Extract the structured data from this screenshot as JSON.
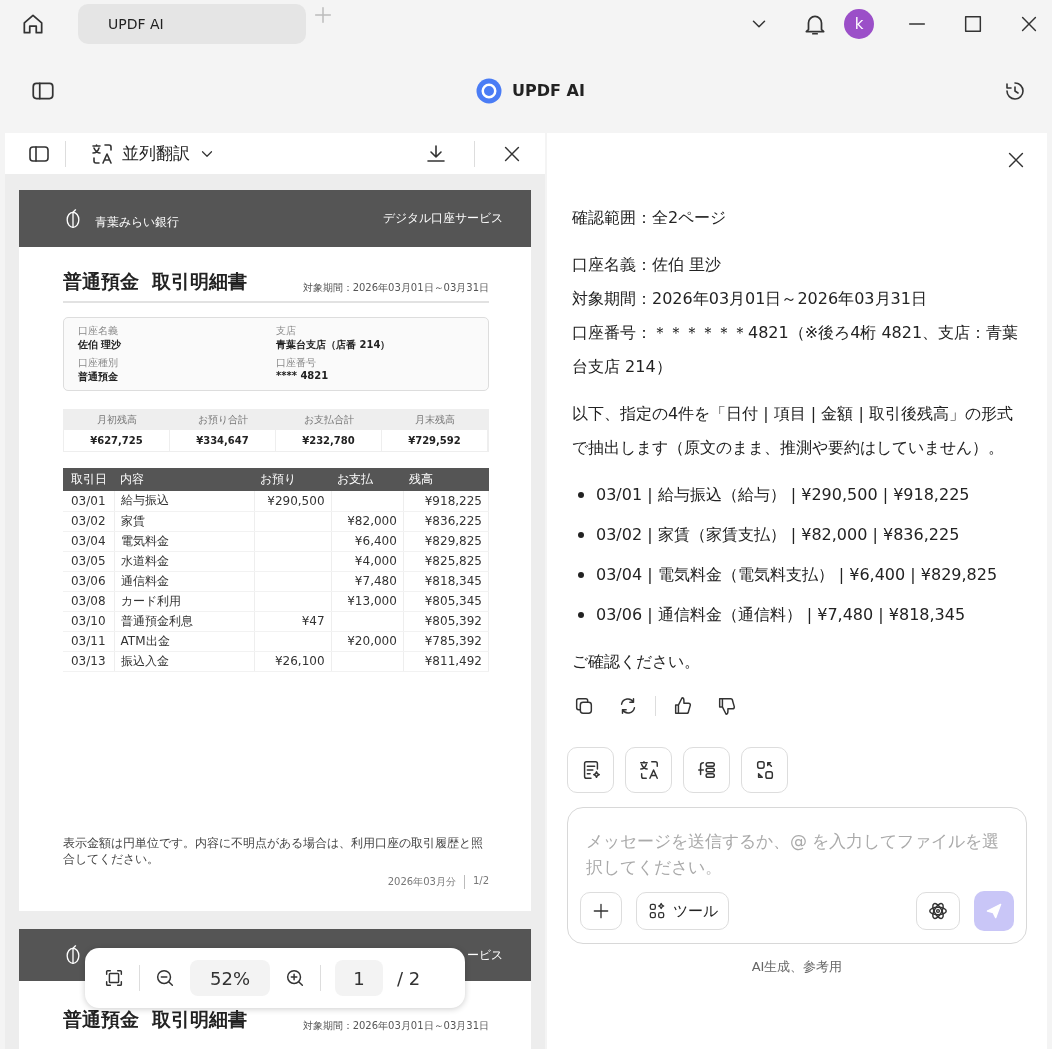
{
  "title_bar": {
    "tabs": [
      {
        "label": "UPDF AI",
        "selected": true
      }
    ],
    "avatar": "k"
  },
  "header": {
    "app_title": "UPDF AI"
  },
  "viewer": {
    "toolbar": {
      "translate_label": "並列翻訳"
    },
    "page": {
      "bank_name": "青葉みらい銀行",
      "service": "デジタル口座サービス",
      "title": "普通預金  取引明細書",
      "period": "対象期間：2026年03月01日～03月31日",
      "info": [
        {
          "label": "口座名義",
          "value": "佐伯 理沙"
        },
        {
          "label": "支店",
          "value": "青葉台支店（店番 214）"
        },
        {
          "label": "口座種別",
          "value": "普通預金"
        },
        {
          "label": "口座番号",
          "value": "**** 4821"
        }
      ],
      "summary": [
        {
          "label": "月初残高",
          "value": "¥627,725"
        },
        {
          "label": "お預り合計",
          "value": "¥334,647"
        },
        {
          "label": "お支払合計",
          "value": "¥232,780"
        },
        {
          "label": "月末残高",
          "value": "¥729,592"
        }
      ],
      "columns": [
        "取引日",
        "内容",
        "お預り",
        "お支払",
        "残高"
      ],
      "rows": [
        {
          "date": "03/01",
          "item": "給与振込",
          "deposit": "¥290,500",
          "balance": "¥918,225"
        },
        {
          "date": "03/02",
          "item": "家賃",
          "withdrawal": "¥82,000",
          "balance": "¥836,225"
        },
        {
          "date": "03/04",
          "item": "電気料金",
          "withdrawal": "¥6,400",
          "balance": "¥829,825"
        },
        {
          "date": "03/05",
          "item": "水道料金",
          "withdrawal": "¥4,000",
          "balance": "¥825,825"
        },
        {
          "date": "03/06",
          "item": "通信料金",
          "withdrawal": "¥7,480",
          "balance": "¥818,345"
        },
        {
          "date": "03/08",
          "item": "カード利用",
          "withdrawal": "¥13,000",
          "balance": "¥805,345"
        },
        {
          "date": "03/10",
          "item": "普通預金利息",
          "deposit": "¥47",
          "balance": "¥805,392"
        },
        {
          "date": "03/11",
          "item": "ATM出金",
          "withdrawal": "¥20,000",
          "balance": "¥785,392"
        },
        {
          "date": "03/13",
          "item": "振込入金",
          "deposit": "¥26,100",
          "balance": "¥811,492"
        }
      ],
      "note": "表示金額は円単位です。内容に不明点がある場合は、利用口座の取引履歴と照合してください。",
      "footer_month": "2026年03月分",
      "footer_page": "1/2"
    },
    "next_page": {
      "service": "ービス",
      "title": "普通預金  取引明細書",
      "period": "対象期間：2026年03月01日～03月31日"
    },
    "zoom_bar": {
      "zoom": "52%",
      "page": "1",
      "total": "/ 2"
    }
  },
  "chat": {
    "paragraphs": [
      {
        "kind": "text",
        "lines": [
          "確認範囲：全2ページ"
        ]
      },
      {
        "kind": "text",
        "lines": [
          "口座名義：佐伯 里沙",
          "対象期間：2026年03月01日～2026年03月31日",
          "口座番号：＊＊＊＊＊＊4821（※後ろ4桁 4821、支店：青葉台支店 214）"
        ]
      },
      {
        "kind": "text",
        "lines": [
          "以下、指定の4件を「日付 | 項目 | 金額 | 取引後残高」の形式で抽出します（原文のまま、推測や要約はしていません）。"
        ]
      },
      {
        "kind": "bullets",
        "lines": [
          "03/01 | 給与振込（給与） | ¥290,500 | ¥918,225",
          "03/02 | 家賃（家賃支払） | ¥82,000 | ¥836,225",
          "03/04 | 電気料金（電気料支払） | ¥6,400 | ¥829,825",
          "03/06 | 通信料金（通信料） | ¥7,480 | ¥818,345"
        ]
      },
      {
        "kind": "text",
        "lines": [
          "ご確認ください。"
        ]
      }
    ],
    "input": {
      "placeholder": "メッセージを送信するか、@ を入力してファイルを選択してください。",
      "tools_label": "ツール"
    },
    "disclaimer": "AI生成、参考用"
  }
}
